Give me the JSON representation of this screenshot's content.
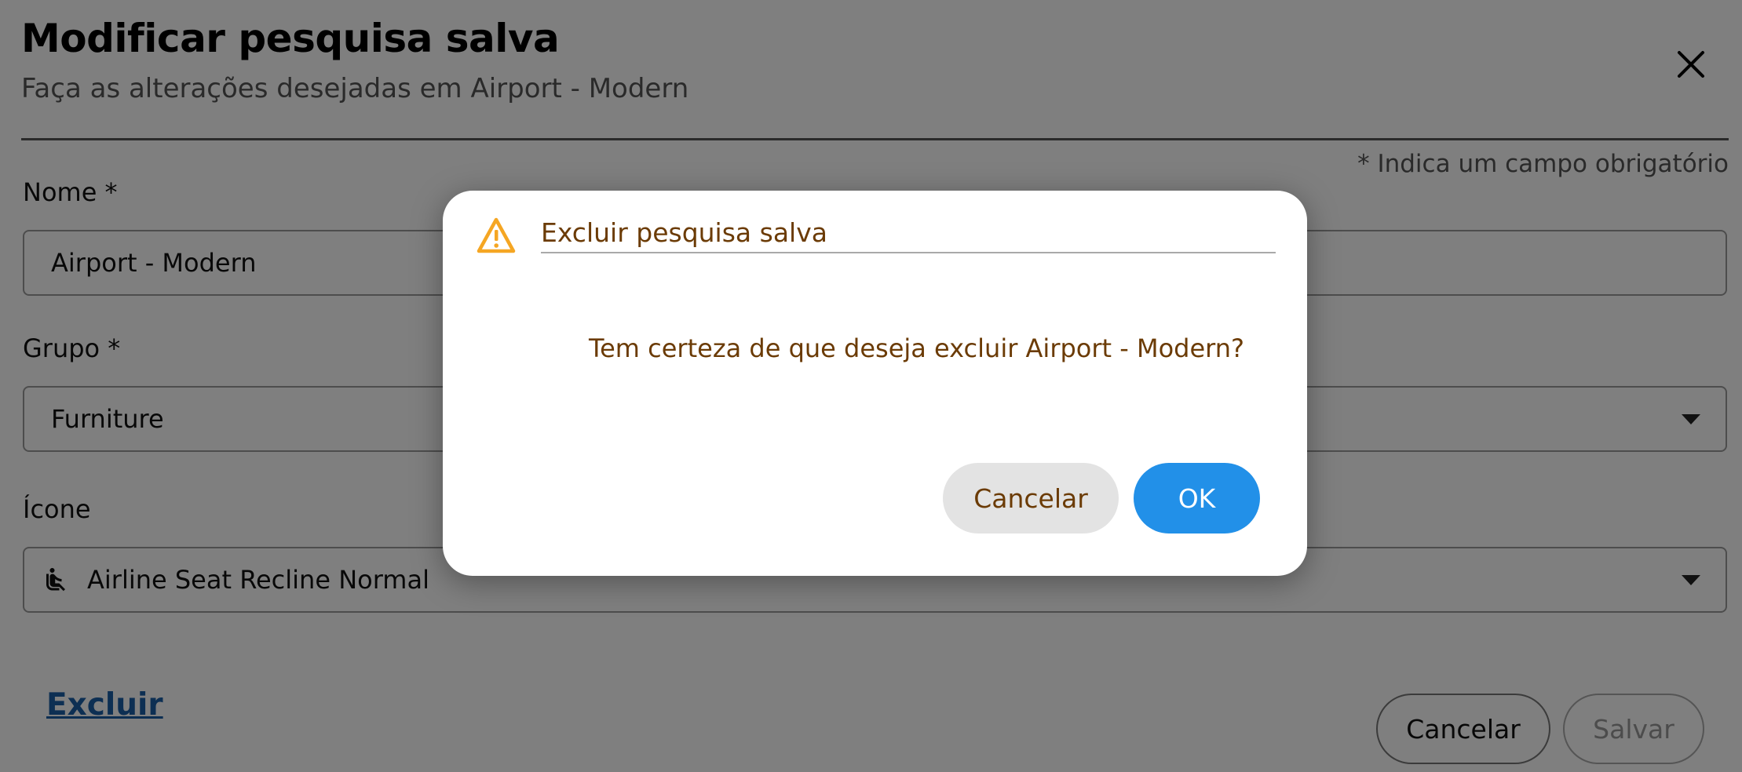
{
  "header": {
    "title": "Modificar pesquisa salva",
    "subtitle": "Faça as alterações desejadas em Airport - Modern"
  },
  "form": {
    "required_note": "* Indica um campo obrigatório",
    "name": {
      "label": "Nome *",
      "value": "Airport - Modern"
    },
    "group": {
      "label": "Grupo *",
      "value": "Furniture"
    },
    "icon": {
      "label": "Ícone",
      "value": "Airline Seat Recline Normal",
      "icon_name": "airline-seat-recline-normal-icon"
    }
  },
  "footer": {
    "delete_label": "Excluir",
    "cancel_label": "Cancelar",
    "save_label": "Salvar"
  },
  "dialog": {
    "title": "Excluir pesquisa salva",
    "message": "Tem certeza de que deseja excluir Airport - Modern?",
    "cancel_label": "Cancelar",
    "ok_label": "OK",
    "icon_name": "warning-icon"
  },
  "colors": {
    "accent": "#2290e8",
    "warning": "#f5a623",
    "dialog_text": "#6b3b05",
    "link": "#1a5fa6"
  }
}
